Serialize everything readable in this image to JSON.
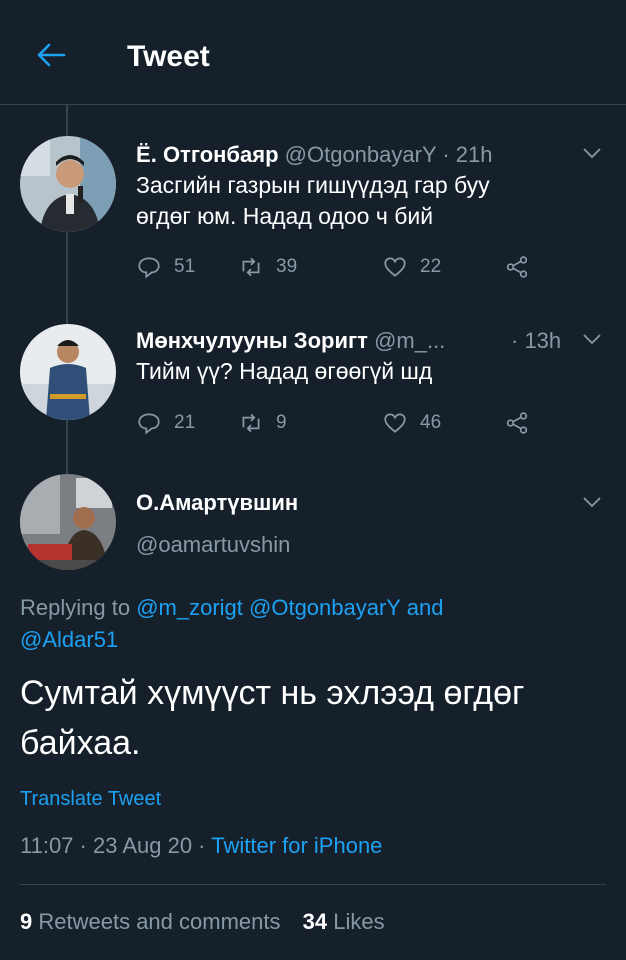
{
  "header": {
    "title": "Tweet"
  },
  "tweets": [
    {
      "name": "Ё. Отгонбаяр",
      "handle": "@OtgonbayarY",
      "time": "· 21h",
      "lines": [
        "Засгийн газрын гишүүдэд гар буу",
        "өгдөг юм. Надад одоо ч бий"
      ],
      "replies": "51",
      "retweets": "39",
      "likes": "22"
    },
    {
      "name": "Мөнхчулууны Зоригт",
      "handle": "@m_...",
      "time": "· 13h",
      "lines": [
        "Тийм үү? Надад өгөөгүй шд"
      ],
      "replies": "21",
      "retweets": "9",
      "likes": "46"
    }
  ],
  "main": {
    "name": "О.Амартүвшин",
    "handle": "@oamartuvshin",
    "replying_prefix": "Replying to",
    "replying_to": "@m_zorigt @OtgonbayarY",
    "replying_and": "and",
    "replying_last": "@Aldar51",
    "lines": [
      "Сумтай хүмүүст нь эхлээд өгдөг",
      "байхаа."
    ],
    "translate": "Translate Tweet",
    "timestamp": "11:07 · 23 Aug 20 ·",
    "source": "Twitter for iPhone",
    "retweets_count": "9",
    "retweets_label": "Retweets and comments",
    "likes_count": "34",
    "likes_label": "Likes"
  },
  "colors": {
    "background": "#15202b",
    "accent": "#1da1f2",
    "muted": "#8899a6",
    "divider": "#38444d"
  }
}
